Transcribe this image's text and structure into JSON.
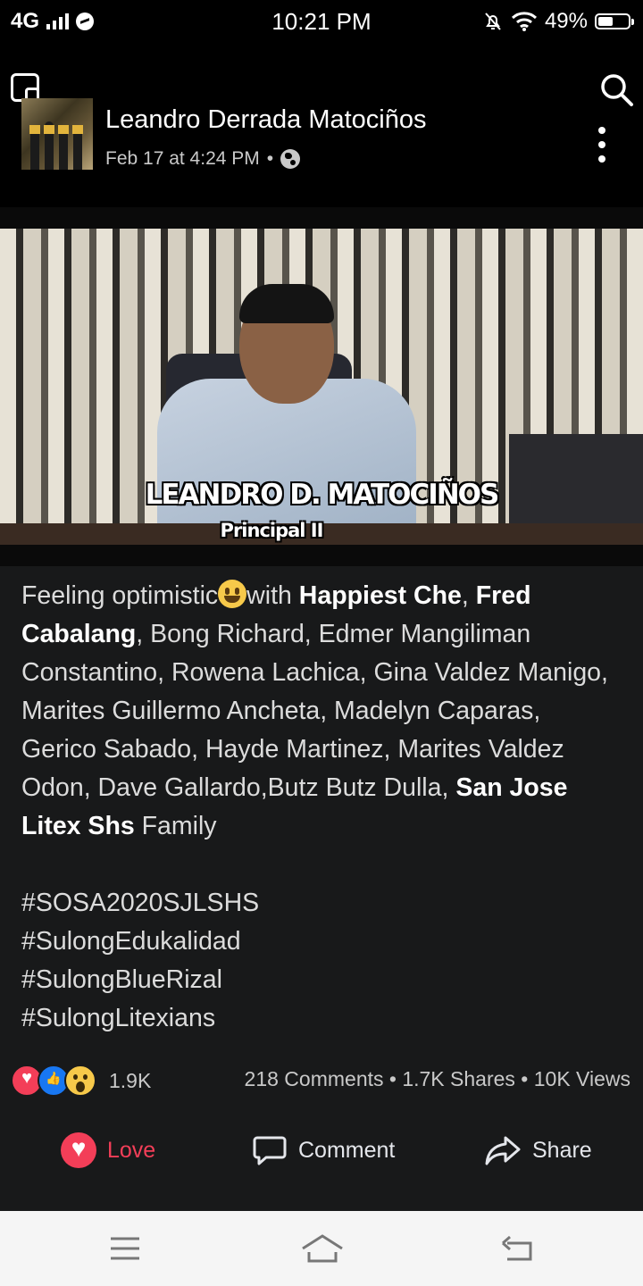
{
  "status_bar": {
    "network": "4G",
    "time": "10:21 PM",
    "battery": "49%",
    "battery_level": 0.49
  },
  "post": {
    "author": "Leandro Derrada Matociños",
    "timestamp": "Feb 17 at 4:24 PM",
    "separator": "•",
    "privacy_icon": "globe-icon"
  },
  "video": {
    "caption_name": "LEANDRO D. MATOCIÑOS",
    "caption_title": "Principal II"
  },
  "text": {
    "p1": "Feeling optimistic",
    "p2": "with ",
    "tag1": "Happiest Che",
    "p3": ", ",
    "tag2": "Fred Cabalang",
    "p4": ", Bong Richard, Edmer Mangiliman Constantino, Rowena Lachica, Gina Valdez Manigo, Marites Guillermo Ancheta, Madelyn Caparas, Gerico Sabado, Hayde Martinez, Marites Valdez Odon, Dave Gallardo,Butz Butz Dulla, ",
    "tag3": "San Jose Litex Shs",
    "p5": " Family"
  },
  "hashtags": [
    "#SOSA2020SJLSHS",
    "#SulongEdukalidad",
    "#SulongBlueRizal",
    "#SulongLitexians"
  ],
  "engagement": {
    "reaction_count": "1.9K",
    "stats": "218 Comments • 1.7K Shares • 10K Views"
  },
  "actions": {
    "love": "Love",
    "comment": "Comment",
    "share": "Share"
  }
}
